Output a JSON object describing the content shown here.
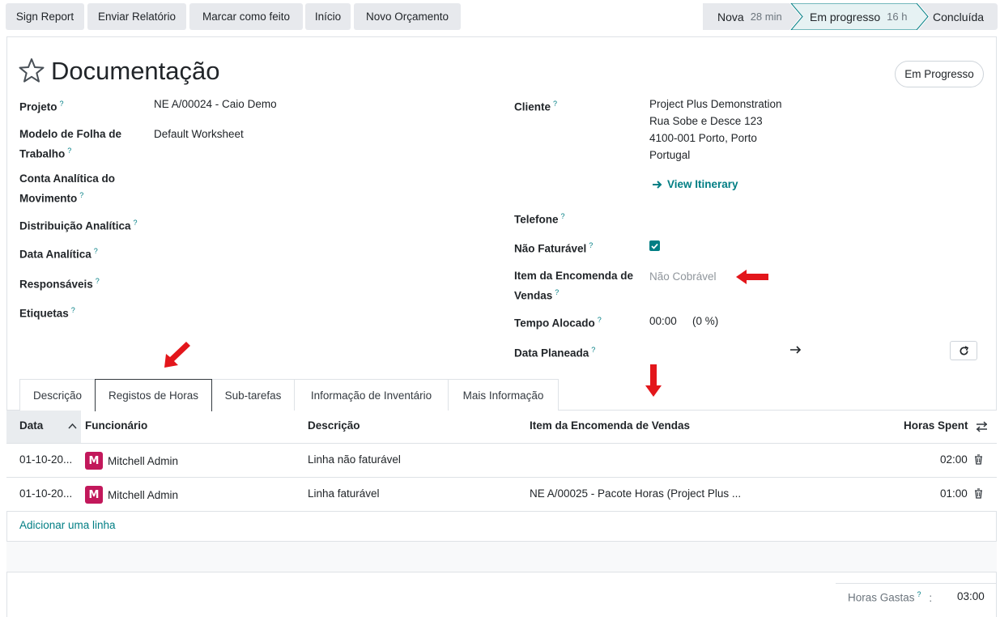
{
  "toolbar": {
    "buttons": [
      "Sign Report",
      "Enviar Relatório",
      "Marcar como feito",
      "Início",
      "Novo Orçamento"
    ]
  },
  "stages": [
    {
      "label": "Nova",
      "duration": "28 min"
    },
    {
      "label": "Em progresso",
      "duration": "16 h"
    },
    {
      "label": "Concluída",
      "duration": ""
    }
  ],
  "record": {
    "title": "Documentação",
    "status_pill": "Em Progresso"
  },
  "left_fields": {
    "projeto_label": "Projeto",
    "projeto_value": "NE A/00024 - Caio Demo",
    "modelo_label_1": "Modelo de Folha de",
    "modelo_label_2": "Trabalho",
    "modelo_value": "Default Worksheet",
    "conta_label_1": "Conta Analítica do",
    "conta_label_2": "Movimento",
    "distribuicao_label": "Distribuição Analítica",
    "data_analitica_label": "Data Analítica",
    "responsaveis_label": "Responsáveis",
    "etiquetas_label": "Etiquetas"
  },
  "right_fields": {
    "cliente_label": "Cliente",
    "cliente_line1": "Project Plus Demonstration",
    "cliente_line2": "Rua Sobe e Desce 123",
    "cliente_line3": "4100-001 Porto, Porto",
    "cliente_line4": "Portugal",
    "itinerary_link": "View Itinerary",
    "telefone_label": "Telefone",
    "nao_faturavel_label": "Não Faturável",
    "nao_faturavel_checked": true,
    "item_label_1": "Item da Encomenda de",
    "item_label_2": "Vendas",
    "item_value": "Não Cobrável",
    "tempo_label": "Tempo Alocado",
    "tempo_value": "00:00",
    "tempo_pct": "(0 %)",
    "data_planeada_label": "Data Planeada"
  },
  "tabs": [
    "Descrição",
    "Registos de Horas",
    "Sub-tarefas",
    "Informação de Inventário",
    "Mais Informação"
  ],
  "active_tab": "Registos de Horas",
  "table": {
    "headers": {
      "data": "Data",
      "funcionario": "Funcionário",
      "descricao": "Descrição",
      "item": "Item da Encomenda de Vendas",
      "horas": "Horas Spent"
    },
    "rows": [
      {
        "data": "01-10-20...",
        "avatar": "M",
        "funcionario": "Mitchell Admin",
        "descricao": "Linha não faturável",
        "item": "",
        "horas": "02:00"
      },
      {
        "data": "01-10-20...",
        "avatar": "M",
        "funcionario": "Mitchell Admin",
        "descricao": "Linha faturável",
        "item": "NE A/00025 - Pacote Horas (Project Plus ...",
        "horas": "01:00"
      }
    ],
    "add_line": "Adicionar uma linha"
  },
  "totals": {
    "label": "Horas Gastas",
    "separator": ":",
    "value": "03:00"
  },
  "colors": {
    "accent": "#017e84",
    "annotation_arrow": "#e3161b",
    "avatar": "#c2185b"
  }
}
